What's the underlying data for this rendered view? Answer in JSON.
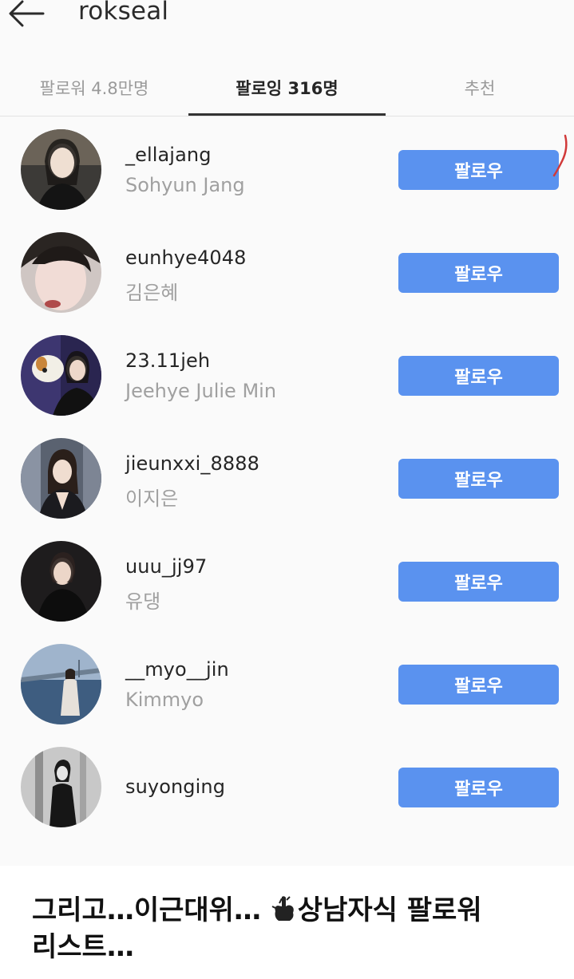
{
  "header": {
    "title": "rokseal",
    "back_icon": "arrow-left-icon"
  },
  "tabs": [
    {
      "label": "팔로워 4.8만명",
      "active": false
    },
    {
      "label": "팔로잉 316명",
      "active": true
    },
    {
      "label": "추천",
      "active": false
    }
  ],
  "follow_button_color": "#5a92ef",
  "users": [
    {
      "username": "_ellajang",
      "name": "Sohyun Jang",
      "button": "팔로우"
    },
    {
      "username": "eunhye4048",
      "name": "김은혜",
      "button": "팔로우"
    },
    {
      "username": "23.11jeh",
      "name": "Jeehye Julie Min",
      "button": "팔로우"
    },
    {
      "username": "jieunxxi_8888",
      "name": "이지은",
      "button": "팔로우"
    },
    {
      "username": "uuu_jj97",
      "name": "유댕",
      "button": "팔로우"
    },
    {
      "username": "__myo__jin",
      "name": "Kimmyo",
      "button": "팔로우"
    },
    {
      "username": "suyonging",
      "name": "",
      "button": "팔로우"
    }
  ],
  "caption": {
    "part1": "그리고…이근대위… ",
    "part2": "상남자식 팔로워",
    "part3": "리스트…"
  }
}
